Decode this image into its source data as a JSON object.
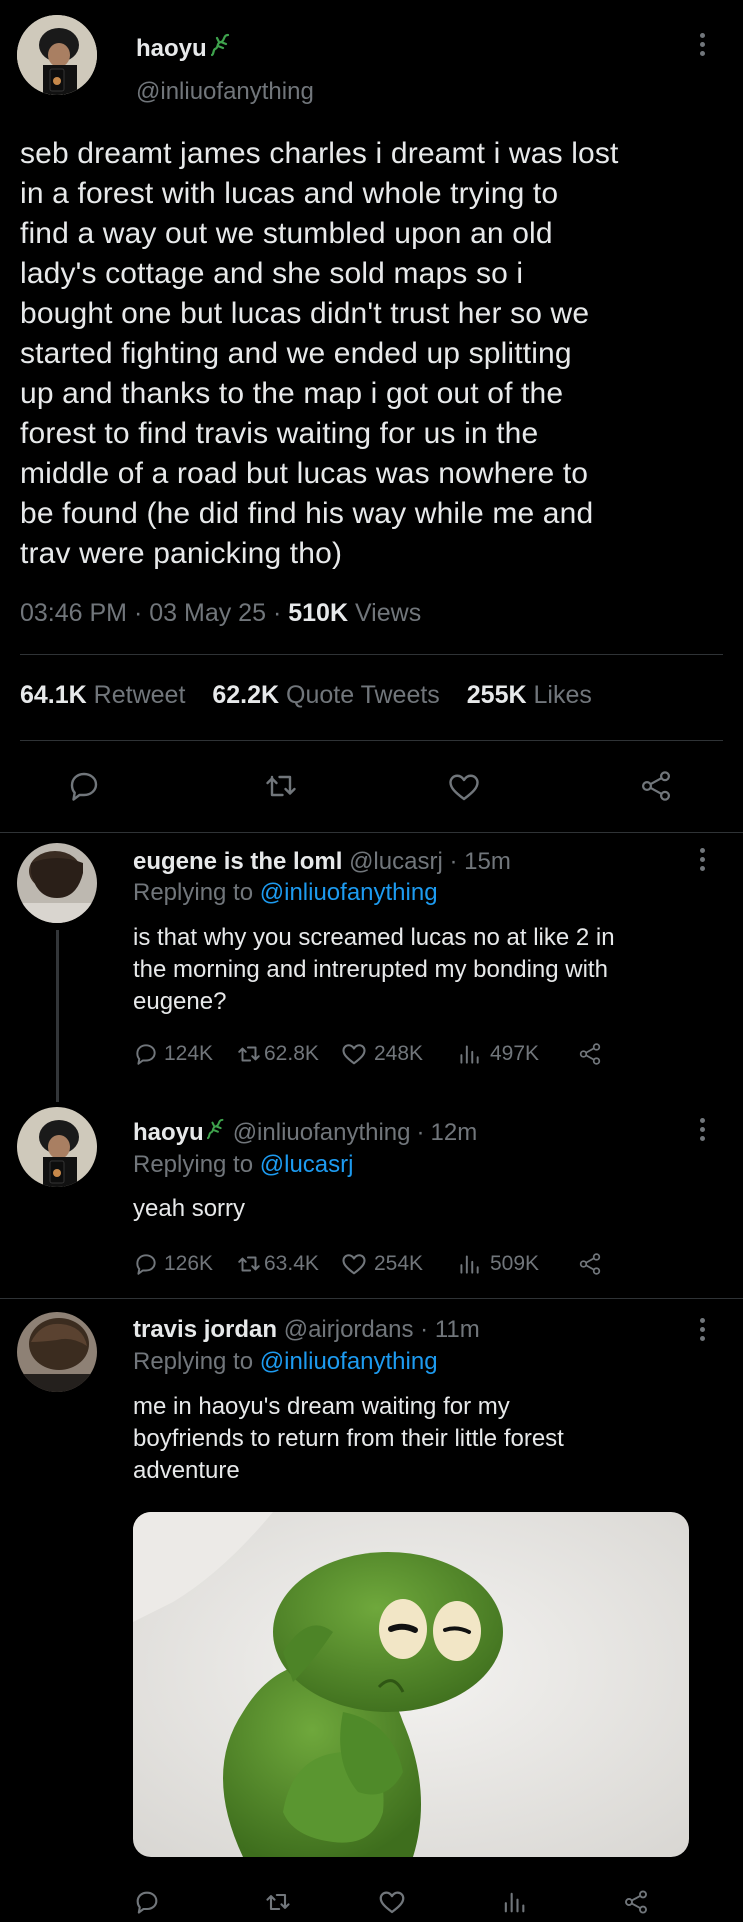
{
  "main_tweet": {
    "name": "haoyu",
    "handle": "@inliuofanything",
    "text": "seb dreamt james charles i dreamt i was lost\nin a forest with lucas and whole trying to\nfind a way out we stumbled upon an old\nlady's cottage and she sold maps so i\nbought one but lucas didn't trust her so we\nstarted fighting and we ended up splitting\nup and thanks to the map i got out of the\nforest to find travis waiting for us in the\nmiddle of a road but lucas was nowhere to\nbe found (he did find his way while me and\ntrav were panicking tho)",
    "time": "03:46 PM",
    "sep1": "·",
    "date": "03 May 25",
    "sep2": "·",
    "views_count": "510K",
    "views_label": "Views",
    "retweets_count": "64.1K",
    "retweets_label": "Retweet",
    "quotes_count": "62.2K",
    "quotes_label": "Quote Tweets",
    "likes_count": "255K",
    "likes_label": "Likes"
  },
  "replies": [
    {
      "name": "eugene is the loml",
      "handle": "@lucasrj",
      "sep": "·",
      "time": "15m",
      "replying_label": "Replying to",
      "replying_to": "@inliuofanything",
      "text": "is that why you screamed lucas no at like 2 in\nthe morning and intrerupted my bonding with\neugene?",
      "stats": {
        "replies": "124K",
        "retweets": "62.8K",
        "likes": "248K",
        "views": "497K"
      }
    },
    {
      "name": "haoyu",
      "handle": "@inliuofanything",
      "sep": "·",
      "time": "12m",
      "replying_label": "Replying to",
      "replying_to": "@lucasrj",
      "text": "yeah sorry",
      "stats": {
        "replies": "126K",
        "retweets": "63.4K",
        "likes": "254K",
        "views": "509K"
      }
    },
    {
      "name": "travis jordan",
      "handle": "@airjordans",
      "sep": "·",
      "time": "11m",
      "replying_label": "Replying to",
      "replying_to": "@inliuofanything",
      "text": "me in haoyu's dream waiting for my\nboyfriends to return from their little forest\nadventure",
      "stats": {}
    }
  ],
  "icons": {
    "verified_badge": "green-lizard-icon",
    "more": "more-vertical-icon",
    "reply": "comment-icon",
    "retweet": "retweet-icon",
    "like": "heart-icon",
    "views": "bar-chart-icon",
    "share": "share-icon"
  },
  "colors": {
    "background": "#000000",
    "text": "#e7e9ea",
    "muted": "#71767b",
    "link": "#1d9bf0",
    "badge": "#3fa34d",
    "divider": "#2f3336"
  }
}
